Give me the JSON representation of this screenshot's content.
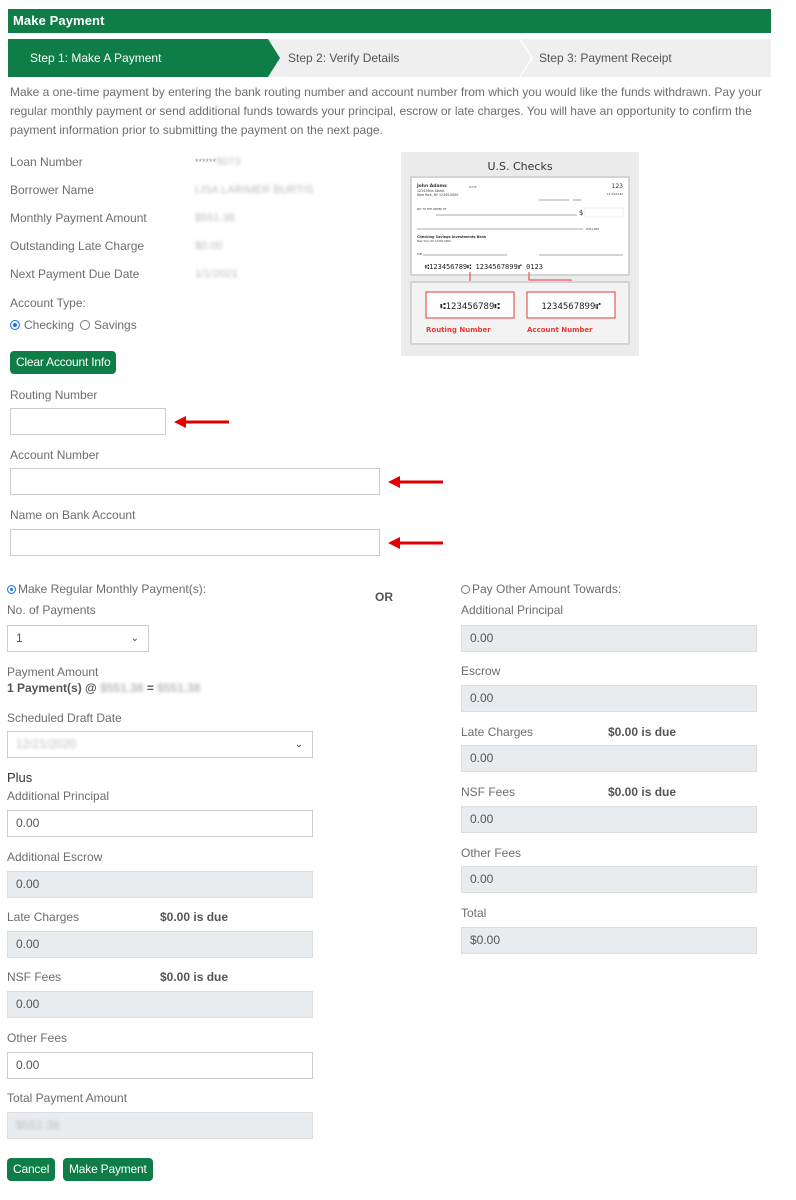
{
  "header": {
    "title": "Make Payment"
  },
  "colors": {
    "brand_green": "#0f7d48",
    "arrow_red": "#e00000",
    "readonly_bg": "#e9ecef"
  },
  "steps": [
    {
      "label": "Step 1: Make A Payment",
      "active": true
    },
    {
      "label": "Step 2: Verify Details",
      "active": false
    },
    {
      "label": "Step 3: Payment Receipt",
      "active": false
    }
  ],
  "intro": "Make a one-time payment by entering the bank routing number and account number from which you would like the funds withdrawn. Pay your regular monthly payment or send additional funds towards your principal, escrow or late charges. You will have an opportunity to confirm the payment information prior to submitting the payment on the next page.",
  "loan_info": [
    {
      "label": "Loan Number",
      "value_prefix": "******",
      "value": "5073"
    },
    {
      "label": "Borrower Name",
      "value": "LISA LARIMER BURTIS"
    },
    {
      "label": "Monthly Payment Amount",
      "value": "$551.38"
    },
    {
      "label": "Outstanding Late Charge",
      "value": "$0.00"
    },
    {
      "label": "Next Payment Due Date",
      "value": "1/1/2021"
    }
  ],
  "account_type": {
    "label": "Account Type:",
    "options": [
      {
        "label": "Checking",
        "selected": true
      },
      {
        "label": "Savings",
        "selected": false
      }
    ]
  },
  "check_image": {
    "title": "U.S. Checks",
    "name": "John Adams",
    "address1": "1234 Main Street",
    "address2": "New York, NY 12345-0000",
    "date_label": "DATE",
    "check_no": "123",
    "fraction": "12-34/1234",
    "pay_to": "PAY TO THE ORDER OF",
    "dollar_sign": "$",
    "dollars": "DOLLARS",
    "bank": "Checking Savings Investments Bank",
    "bank_addr": "New York, NY 12345-0000",
    "for_label": "FOR",
    "micr_line": "⑆123456789⑆  1234567899⑈  0123",
    "routing_micr": "⑆123456789⑆",
    "account_micr": "1234567899⑈",
    "routing_caption": "Routing Number",
    "account_caption": "Account Number"
  },
  "buttons": {
    "clear_account": "Clear Account Info",
    "cancel": "Cancel",
    "make_payment": "Make Payment"
  },
  "bank_fields": {
    "routing": {
      "label": "Routing Number",
      "value": ""
    },
    "account": {
      "label": "Account Number",
      "value": ""
    },
    "name": {
      "label": "Name on Bank Account",
      "value": ""
    }
  },
  "regular": {
    "radio_label": "Make Regular Monthly Payment(s):",
    "selected": true,
    "num_payments_label": "No. of Payments",
    "num_payments_value": "1",
    "payment_amount_label": "Payment Amount",
    "payment_amount_prefix": "1 Payment(s) @",
    "payment_amount_each": "$551.38",
    "payment_amount_eq": "=",
    "payment_amount_total": "$551.38",
    "draft_date_label": "Scheduled Draft Date",
    "draft_date_value": "12/21/2020",
    "plus_label": "Plus",
    "additional_principal": {
      "label": "Additional Principal",
      "value": "0.00"
    },
    "additional_escrow": {
      "label": "Additional Escrow",
      "value": "0.00"
    },
    "late_charges": {
      "label": "Late Charges",
      "due": "$0.00 is due",
      "value": "0.00"
    },
    "nsf_fees": {
      "label": "NSF Fees",
      "due": "$0.00 is due",
      "value": "0.00"
    },
    "other_fees": {
      "label": "Other Fees",
      "value": "0.00"
    },
    "total": {
      "label": "Total Payment Amount",
      "value": "$551.38"
    }
  },
  "or_label": "OR",
  "other": {
    "radio_label": "Pay Other Amount Towards:",
    "selected": false,
    "additional_principal": {
      "label": "Additional Principal",
      "value": "0.00"
    },
    "escrow": {
      "label": "Escrow",
      "value": "0.00"
    },
    "late_charges": {
      "label": "Late Charges",
      "due": "$0.00 is due",
      "value": "0.00"
    },
    "nsf_fees": {
      "label": "NSF Fees",
      "due": "$0.00 is due",
      "value": "0.00"
    },
    "other_fees": {
      "label": "Other Fees",
      "value": "0.00"
    },
    "total": {
      "label": "Total",
      "value": "$0.00"
    }
  }
}
